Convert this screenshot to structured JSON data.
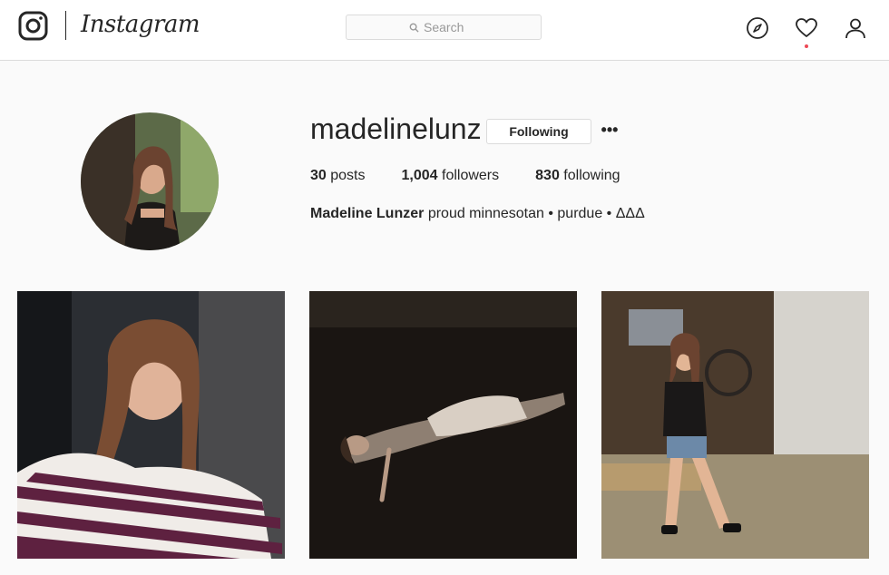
{
  "header": {
    "brand": "Instagram",
    "search_placeholder": "Search",
    "icons": [
      "instagram-camera-icon",
      "search-icon",
      "compass-icon",
      "heart-icon",
      "person-icon"
    ],
    "notification_dot_color": "#ed4956"
  },
  "profile": {
    "username": "madelinelunz",
    "follow_button": "Following",
    "more_button": "•••",
    "stats": {
      "posts_count": "30",
      "posts_label": "posts",
      "followers_count": "1,004",
      "followers_label": "followers",
      "following_count": "830",
      "following_label": "following"
    },
    "full_name": "Madeline Lunzer",
    "bio": "proud minnesotan • purdue • ΔΔΔ"
  },
  "colors": {
    "text": "#262626",
    "border": "#dbdbdb",
    "background": "#fafafa"
  }
}
